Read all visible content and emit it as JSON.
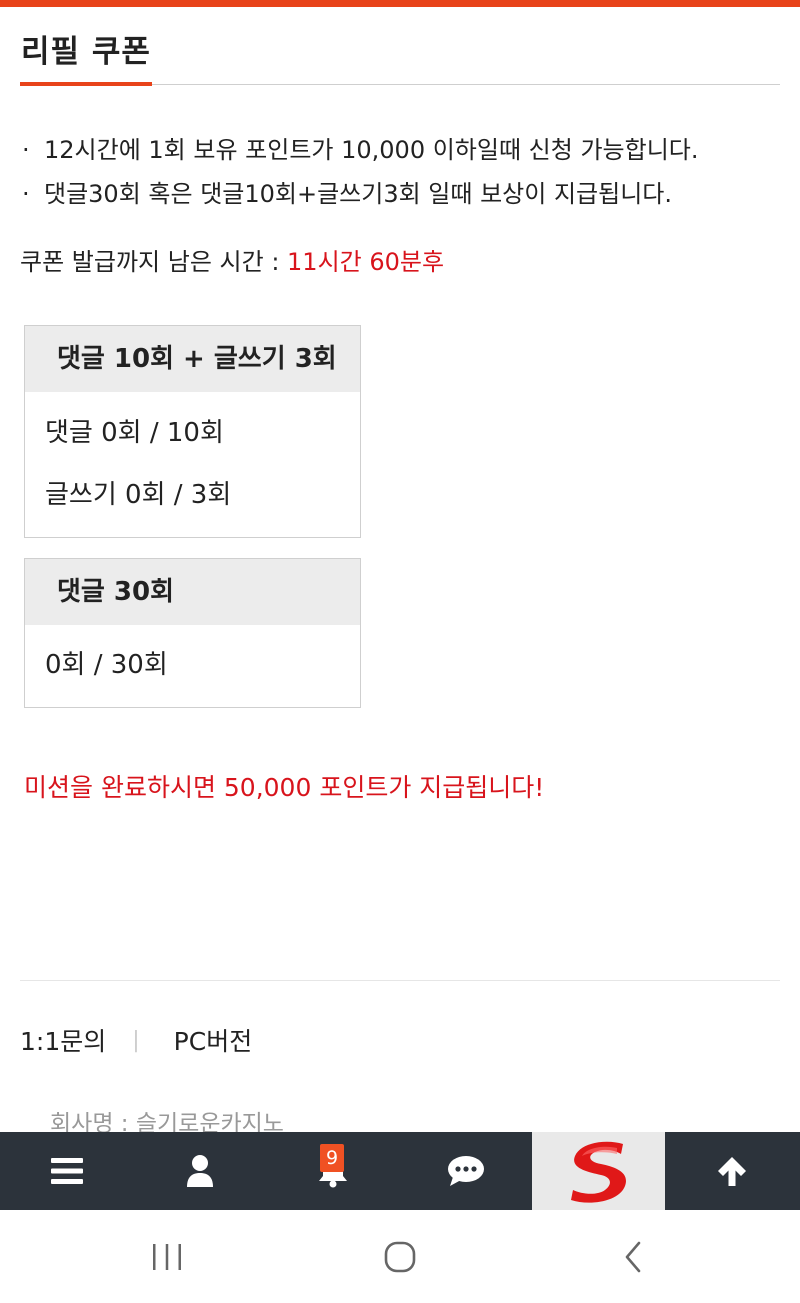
{
  "header": {
    "title": "리필 쿠폰",
    "accent_color": "#e8431a"
  },
  "rules": [
    {
      "bullet": "·",
      "text": "12시간에 1회 보유 포인트가 10,000 이하일때 신청 가능합니다."
    },
    {
      "bullet": "·",
      "text": "댓글30회 혹은 댓글10회+글쓰기3회 일때 보상이 지급됩니다."
    }
  ],
  "remaining": {
    "label": "쿠폰 발급까지 남은 시간 : ",
    "value": "11시간 60분후",
    "value_color": "#d8141c"
  },
  "missions": [
    {
      "title": "댓글 10회 + 글쓰기 3회",
      "rows": [
        "댓글 0회 / 10회",
        "글쓰기 0회 / 3회"
      ]
    },
    {
      "title": "댓글 30회",
      "rows": [
        "0회 / 30회"
      ]
    }
  ],
  "reward_text": "미션을 완료하시면 50,000 포인트가 지급됩니다!",
  "footer": {
    "links": [
      "1:1문의",
      "PC버전"
    ],
    "separator": "|",
    "company": "회사명 : 슬기로운카지노"
  },
  "bottom_nav": {
    "items": [
      {
        "icon": "menu-icon"
      },
      {
        "icon": "user-icon"
      },
      {
        "icon": "bell-icon",
        "badge": "9"
      },
      {
        "icon": "chat-icon"
      },
      {
        "icon": "site-logo"
      },
      {
        "icon": "arrow-up-icon"
      }
    ],
    "background": "#2c333b",
    "badge_color": "#f05123"
  },
  "system_nav": {
    "icons": [
      "recent-apps-icon",
      "home-icon",
      "back-icon"
    ]
  }
}
